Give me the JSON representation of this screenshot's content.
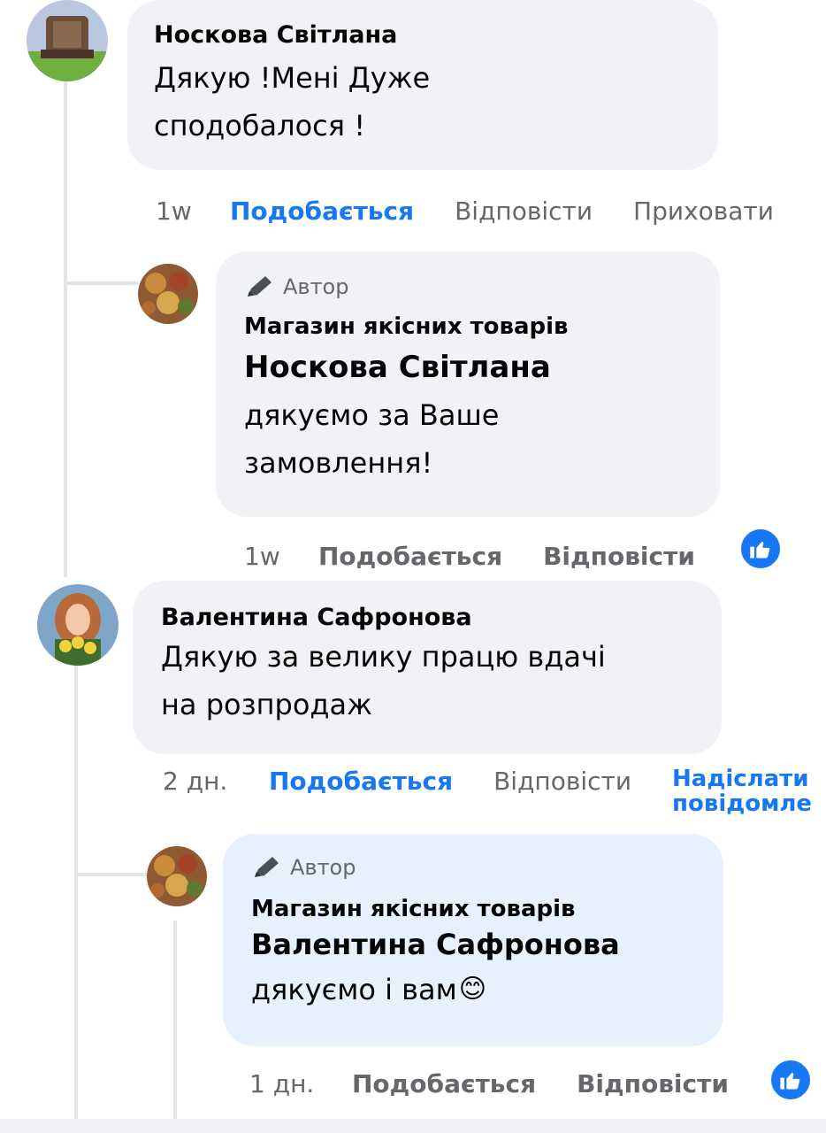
{
  "comments": [
    {
      "author": "Носкова Світлана",
      "text_line1": "Дякую !Мені Дуже",
      "text_line2": "сподобалося !",
      "time": "1w",
      "like_label": "Подобається",
      "reply_label": "Відповісти",
      "hide_label": "Приховати",
      "liked": true,
      "reply": {
        "author_badge": "Автор",
        "page_name": "Магазин якісних товарів",
        "mention": "Носкова Світлана",
        "text_line1": "дякуємо за Ваше",
        "text_line2": "замовлення!",
        "time": "1w",
        "like_label": "Подобається",
        "reply_label": "Відповісти",
        "reaction_icon": "like-icon"
      }
    },
    {
      "author": "Валентина Сафронова",
      "text_line1": "Дякую за велику працю вдачі",
      "text_line2": "на розпродаж",
      "time": "2 дн.",
      "like_label": "Подобається",
      "reply_label": "Відповісти",
      "send_label_line1": "Надіслати",
      "send_label_line2": "повідомле",
      "liked": true,
      "reply": {
        "author_badge": "Автор",
        "page_name": "Магазин якісних товарів",
        "mention": "Валентина Сафронова",
        "text": "дякуємо і вам",
        "emoji": "😊",
        "time": "1 дн.",
        "like_label": "Подобається",
        "reply_label": "Відповісти",
        "reaction_icon": "like-icon"
      }
    }
  ],
  "colors": {
    "accent": "#1877f2",
    "bubble": "#f0f2f5",
    "bubble_highlight": "#e7f0fd",
    "secondary_text": "#65676b"
  }
}
